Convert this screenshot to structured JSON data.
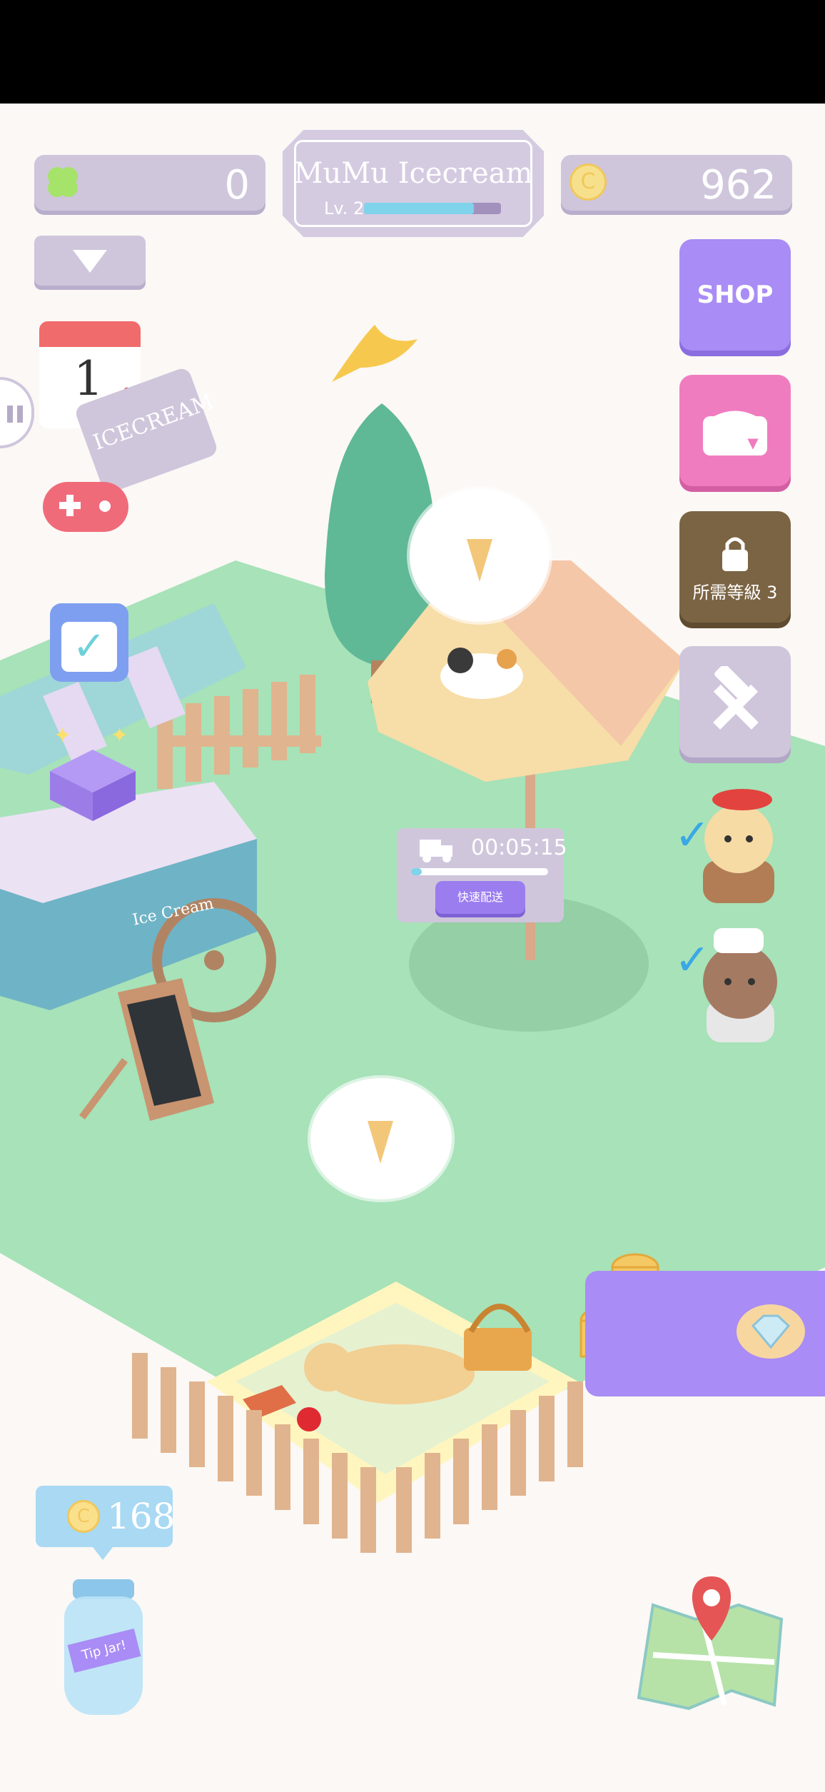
{
  "header": {
    "title": "MuMu Icecream",
    "level_label": "Lv. 2",
    "level_progress": 0.8,
    "clover_count": "0",
    "coin_count": "962"
  },
  "side_buttons": {
    "shop_label": "SHOP",
    "locked_label": "所需等級 3"
  },
  "delivery": {
    "timer": "00:05:15",
    "button_label": "快速配送",
    "progress": 0.08
  },
  "tip_jar": {
    "amount": "168",
    "jar_label": "Tip Jar!"
  },
  "calendar": {
    "day": "1"
  },
  "signboard_text": "ICECREAM",
  "chalkboard_text": "Ice Cream",
  "colors": {
    "grass": "#a7e2b8",
    "panel": "#cfc6dc",
    "shop_purple": "#a98cf5",
    "gift_pink": "#f07cc0",
    "locked_brown": "#7b6443",
    "level_bar": "#7fd3ea",
    "deliver_purple": "#9b7df0",
    "tip_blue": "#a9d9f3"
  }
}
